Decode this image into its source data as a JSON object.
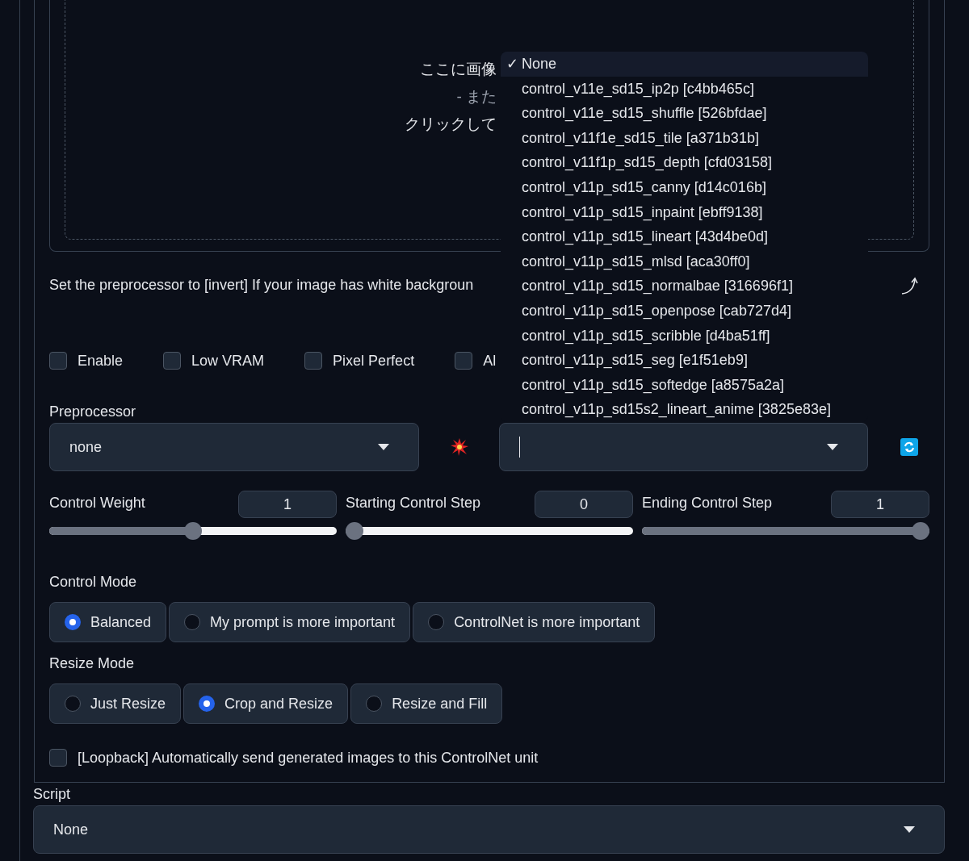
{
  "upload": {
    "lines": [
      {
        "text": "ここに画像",
        "muted": false
      },
      {
        "text": "- また",
        "muted": true
      },
      {
        "text": "クリックして",
        "muted": false
      }
    ]
  },
  "hint": "Set the preprocessor to [invert] If your image has white backgroun",
  "options": [
    {
      "label": "Enable",
      "checked": false
    },
    {
      "label": "Low VRAM",
      "checked": false
    },
    {
      "label": "Pixel Perfect",
      "checked": false
    },
    {
      "label": "Al",
      "checked": false
    }
  ],
  "preprocessor": {
    "label": "Preprocessor",
    "value": "none"
  },
  "model": {
    "focused": true
  },
  "sliders": [
    {
      "label": "Control Weight",
      "value": "1",
      "level": 0.5
    },
    {
      "label": "Starting Control Step",
      "value": "0",
      "level": 0
    },
    {
      "label": "Ending Control Step",
      "value": "1",
      "level": 1
    }
  ],
  "control_mode": {
    "label": "Control Mode",
    "options": [
      {
        "label": "Balanced",
        "selected": true
      },
      {
        "label": "My prompt is more important",
        "selected": false
      },
      {
        "label": "ControlNet is more important",
        "selected": false
      }
    ]
  },
  "resize_mode": {
    "label": "Resize Mode",
    "options": [
      {
        "label": "Just Resize",
        "selected": false
      },
      {
        "label": "Crop and Resize",
        "selected": true
      },
      {
        "label": "Resize and Fill",
        "selected": false
      }
    ]
  },
  "loopback": {
    "label": "[Loopback] Automatically send generated images to this ControlNet unit",
    "checked": false
  },
  "script": {
    "label": "Script",
    "value": "None"
  },
  "dropdown": {
    "check_mark": "✓",
    "items": [
      {
        "label": "None",
        "selected": true
      },
      {
        "label": "control_v11e_sd15_ip2p [c4bb465c]",
        "selected": false
      },
      {
        "label": "control_v11e_sd15_shuffle [526bfdae]",
        "selected": false
      },
      {
        "label": "control_v11f1e_sd15_tile [a371b31b]",
        "selected": false
      },
      {
        "label": "control_v11f1p_sd15_depth [cfd03158]",
        "selected": false
      },
      {
        "label": "control_v11p_sd15_canny [d14c016b]",
        "selected": false
      },
      {
        "label": "control_v11p_sd15_inpaint [ebff9138]",
        "selected": false
      },
      {
        "label": "control_v11p_sd15_lineart [43d4be0d]",
        "selected": false
      },
      {
        "label": "control_v11p_sd15_mlsd [aca30ff0]",
        "selected": false
      },
      {
        "label": "control_v11p_sd15_normalbae [316696f1]",
        "selected": false
      },
      {
        "label": "control_v11p_sd15_openpose [cab727d4]",
        "selected": false
      },
      {
        "label": "control_v11p_sd15_scribble [d4ba51ff]",
        "selected": false
      },
      {
        "label": "control_v11p_sd15_seg [e1f51eb9]",
        "selected": false
      },
      {
        "label": "control_v11p_sd15_softedge [a8575a2a]",
        "selected": false
      },
      {
        "label": "control_v11p_sd15s2_lineart_anime [3825e83e]",
        "selected": false
      }
    ]
  }
}
